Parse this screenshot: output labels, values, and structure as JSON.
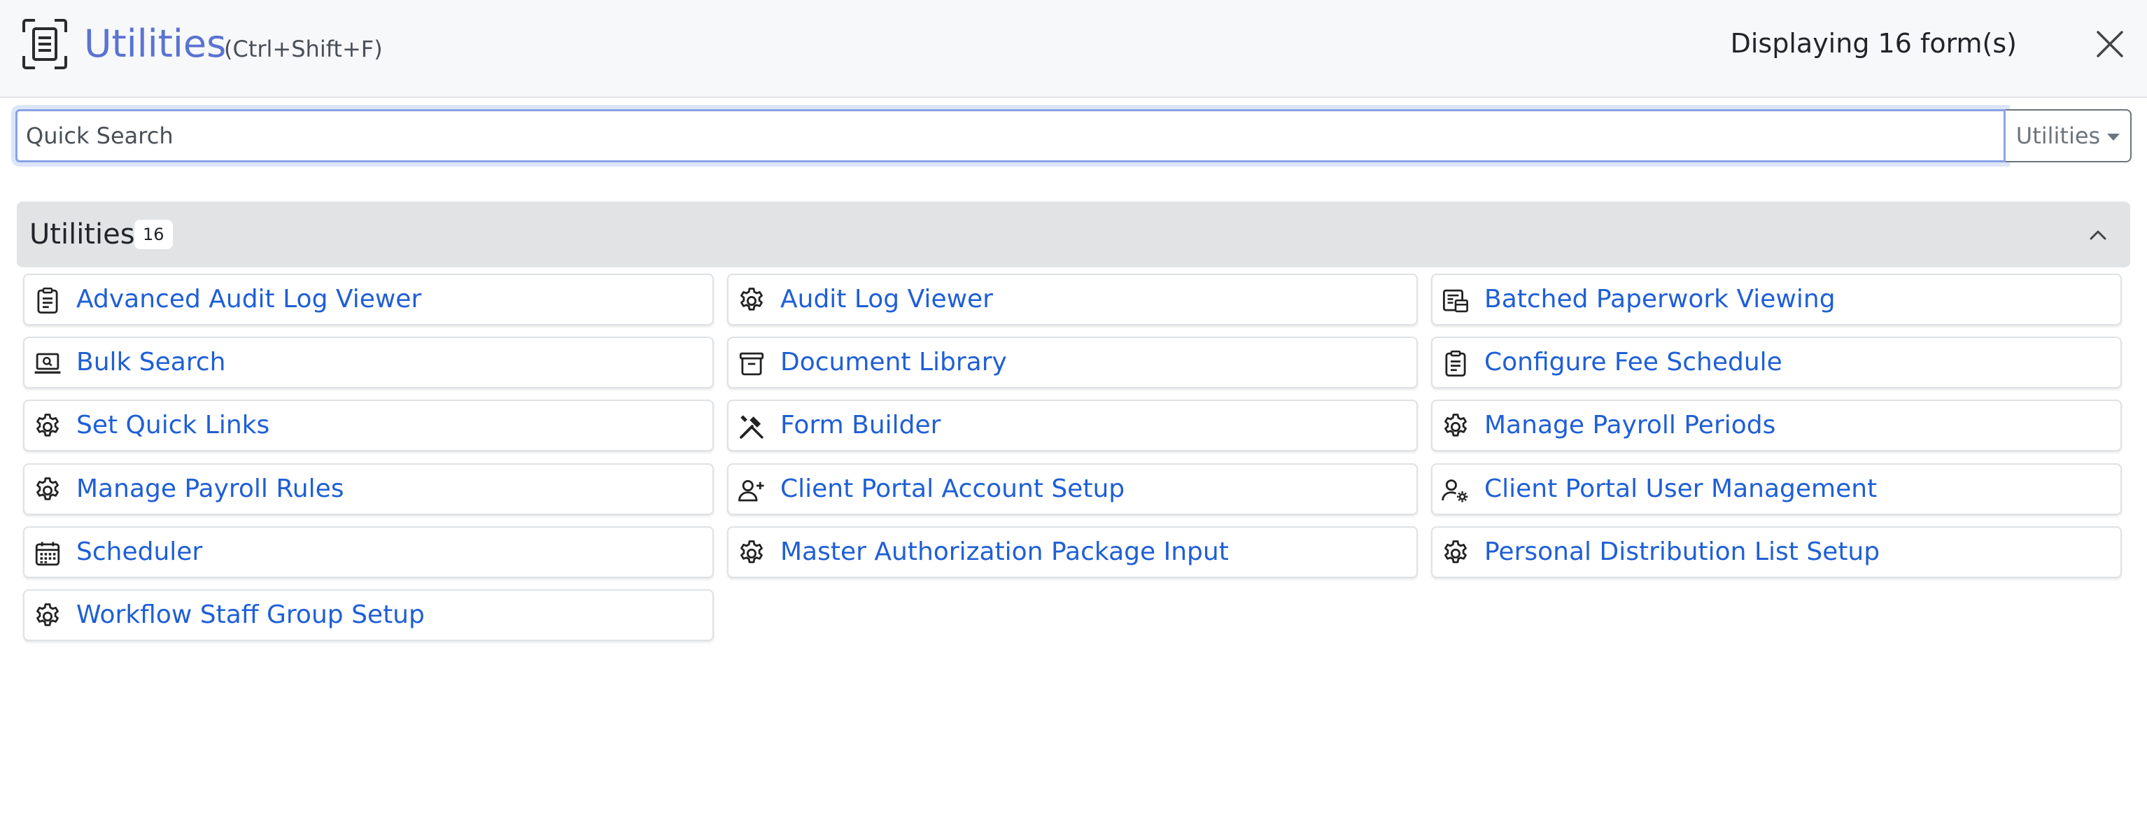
{
  "header": {
    "title": "Utilities",
    "shortcut": "(Ctrl+Shift+F)",
    "count_text": "Displaying 16 form(s)"
  },
  "search": {
    "placeholder": "Quick Search",
    "value": "",
    "scope_label": "Utilities"
  },
  "group": {
    "title": "Utilities",
    "badge": "16"
  },
  "colors": {
    "accent_title": "#5b73d1",
    "link": "#1f5fd6",
    "group_bg": "#e2e3e5",
    "header_bg": "#f7f8fa"
  },
  "items": [
    {
      "label": "Advanced Audit Log Viewer",
      "icon": "clipboard-list-icon"
    },
    {
      "label": "Audit Log Viewer",
      "icon": "gear-icon"
    },
    {
      "label": "Batched Paperwork Viewing",
      "icon": "documents-stack-icon"
    },
    {
      "label": "Bulk Search",
      "icon": "laptop-search-icon"
    },
    {
      "label": "Document Library",
      "icon": "archive-box-icon"
    },
    {
      "label": "Configure Fee Schedule",
      "icon": "clipboard-list-icon"
    },
    {
      "label": "Set Quick Links",
      "icon": "gear-icon"
    },
    {
      "label": "Form Builder",
      "icon": "hammer-wrench-icon"
    },
    {
      "label": "Manage Payroll Periods",
      "icon": "gear-icon"
    },
    {
      "label": "Manage Payroll Rules",
      "icon": "gear-icon"
    },
    {
      "label": "Client Portal Account Setup",
      "icon": "user-plus-icon"
    },
    {
      "label": "Client Portal User Management",
      "icon": "user-gear-icon"
    },
    {
      "label": "Scheduler",
      "icon": "calendar-icon"
    },
    {
      "label": "Master Authorization Package Input",
      "icon": "gear-icon"
    },
    {
      "label": "Personal Distribution List Setup",
      "icon": "gear-icon"
    },
    {
      "label": "Workflow Staff Group Setup",
      "icon": "gear-icon"
    }
  ]
}
